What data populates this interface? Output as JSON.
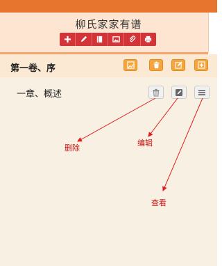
{
  "header": {
    "book_title": "柳氏家家有谱",
    "toolbar": [
      {
        "icon": "plus-icon"
      },
      {
        "icon": "pencil-icon"
      },
      {
        "icon": "book-icon"
      },
      {
        "icon": "image-icon"
      },
      {
        "icon": "paperclip-icon"
      },
      {
        "icon": "print-icon"
      }
    ],
    "toolbar_color": "#d23437"
  },
  "volume": {
    "title": "第一卷、序",
    "actions": [
      {
        "icon": "image-edit-icon"
      },
      {
        "icon": "trash-icon"
      },
      {
        "icon": "edit-icon"
      },
      {
        "icon": "plus-icon"
      }
    ],
    "action_color": "#f4a53e"
  },
  "chapter": {
    "title": "一章、概述",
    "actions": [
      {
        "icon": "trash-icon"
      },
      {
        "icon": "edit-icon"
      },
      {
        "icon": "menu-icon"
      }
    ]
  },
  "annotations": {
    "delete": "删除",
    "edit": "编辑",
    "view": "查看",
    "color": "#c81414"
  }
}
